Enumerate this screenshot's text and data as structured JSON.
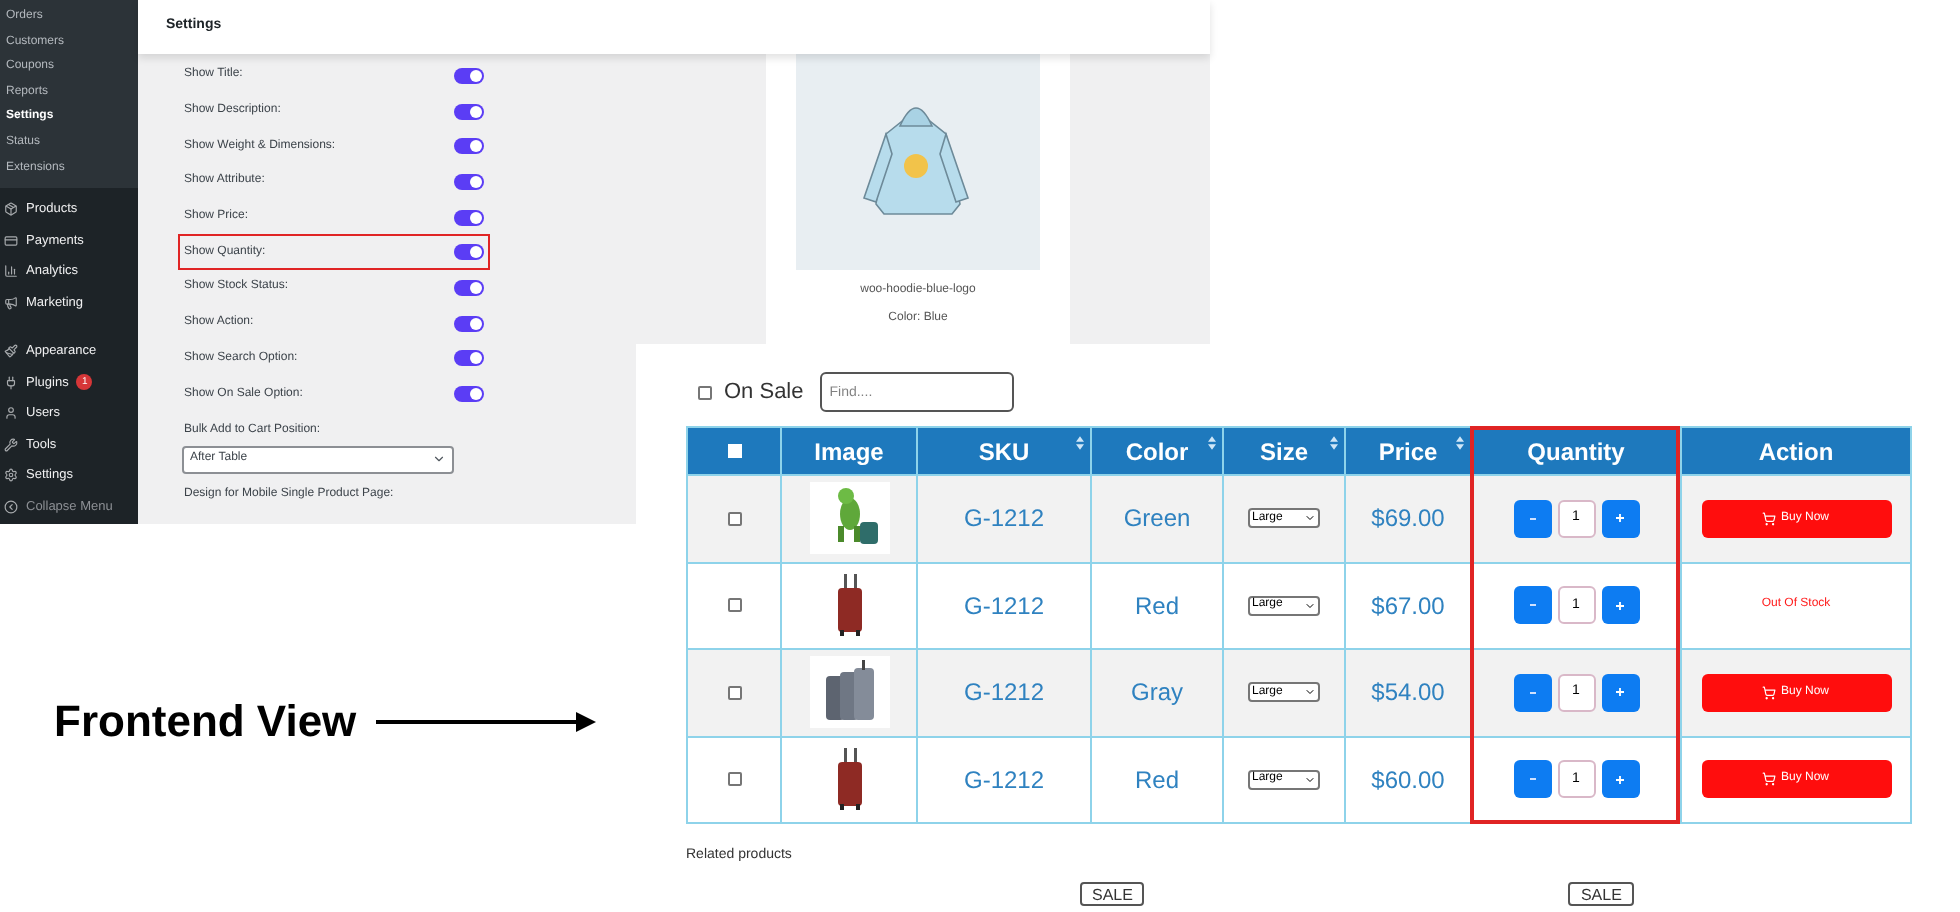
{
  "sidebar": {
    "submenu": [
      {
        "label": "Orders",
        "selected": false
      },
      {
        "label": "Customers",
        "selected": false
      },
      {
        "label": "Coupons",
        "selected": false
      },
      {
        "label": "Reports",
        "selected": false
      },
      {
        "label": "Settings",
        "selected": true
      },
      {
        "label": "Status",
        "selected": false
      },
      {
        "label": "Extensions",
        "selected": false
      }
    ],
    "menu_groups": [
      [
        {
          "label": "Products"
        },
        {
          "label": "Payments"
        },
        {
          "label": "Analytics"
        },
        {
          "label": "Marketing"
        }
      ],
      [
        {
          "label": "Appearance"
        },
        {
          "label": "Plugins",
          "badge": "1"
        },
        {
          "label": "Users"
        },
        {
          "label": "Tools"
        },
        {
          "label": "Settings"
        },
        {
          "label": "Collapse Menu",
          "muted": true
        }
      ]
    ]
  },
  "settings_page": {
    "title": "Settings",
    "options": [
      {
        "label": "Show Title:",
        "on": true,
        "highlighted": false
      },
      {
        "label": "Show Description:",
        "on": true,
        "highlighted": false
      },
      {
        "label": "Show Weight & Dimensions:",
        "on": true,
        "highlighted": false
      },
      {
        "label": "Show Attribute:",
        "on": true,
        "highlighted": false
      },
      {
        "label": "Show Price:",
        "on": true,
        "highlighted": false
      },
      {
        "label": "Show Quantity:",
        "on": true,
        "highlighted": true
      },
      {
        "label": "Show Stock Status:",
        "on": true,
        "highlighted": false
      },
      {
        "label": "Show Action:",
        "on": true,
        "highlighted": false
      },
      {
        "label": "Show Search Option:",
        "on": true,
        "highlighted": false
      },
      {
        "label": "Show On Sale Option:",
        "on": true,
        "highlighted": false
      }
    ],
    "bulk_position": {
      "label": "Bulk Add to Cart Position:",
      "value": "After Table"
    },
    "mobile_design_label": "Design for Mobile Single Product Page:"
  },
  "product_preview": {
    "name": "woo-hoodie-blue-logo",
    "attribute": "Color: Blue"
  },
  "caption": "Frontend View",
  "frontend": {
    "on_sale": {
      "label": "On Sale",
      "checked": false
    },
    "search": {
      "placeholder": "Find...."
    },
    "table": {
      "select_all_checked": false,
      "columns": [
        {
          "kind": "checkbox",
          "sortable": false,
          "highlighted": false
        },
        {
          "label": "Image",
          "sortable": false,
          "highlighted": false
        },
        {
          "label": "SKU",
          "sortable": true,
          "highlighted": false
        },
        {
          "label": "Color",
          "sortable": true,
          "highlighted": false
        },
        {
          "label": "Size",
          "sortable": true,
          "highlighted": false
        },
        {
          "label": "Price",
          "sortable": true,
          "highlighted": false
        },
        {
          "label": "Quantity",
          "sortable": false,
          "highlighted": true
        },
        {
          "label": "Action",
          "sortable": false,
          "highlighted": false
        }
      ],
      "rows": [
        {
          "checked": false,
          "sku": "G-1212",
          "color_name": "Green",
          "size": "Large",
          "price": "$69.00",
          "quantity": "1",
          "action": {
            "kind": "button",
            "label": "Buy Now"
          }
        },
        {
          "checked": false,
          "sku": "G-1212",
          "color_name": "Red",
          "size": "Large",
          "price": "$67.00",
          "quantity": "1",
          "action": {
            "kind": "status",
            "label": "Out Of Stock"
          }
        },
        {
          "checked": false,
          "sku": "G-1212",
          "color_name": "Gray",
          "size": "Large",
          "price": "$54.00",
          "quantity": "1",
          "action": {
            "kind": "button",
            "label": "Buy Now"
          }
        },
        {
          "checked": false,
          "sku": "G-1212",
          "color_name": "Red",
          "size": "Large",
          "price": "$60.00",
          "quantity": "1",
          "action": {
            "kind": "button",
            "label": "Buy Now"
          }
        }
      ]
    },
    "related_title": "Related products",
    "sale_badges": [
      "SALE",
      "SALE"
    ]
  }
}
